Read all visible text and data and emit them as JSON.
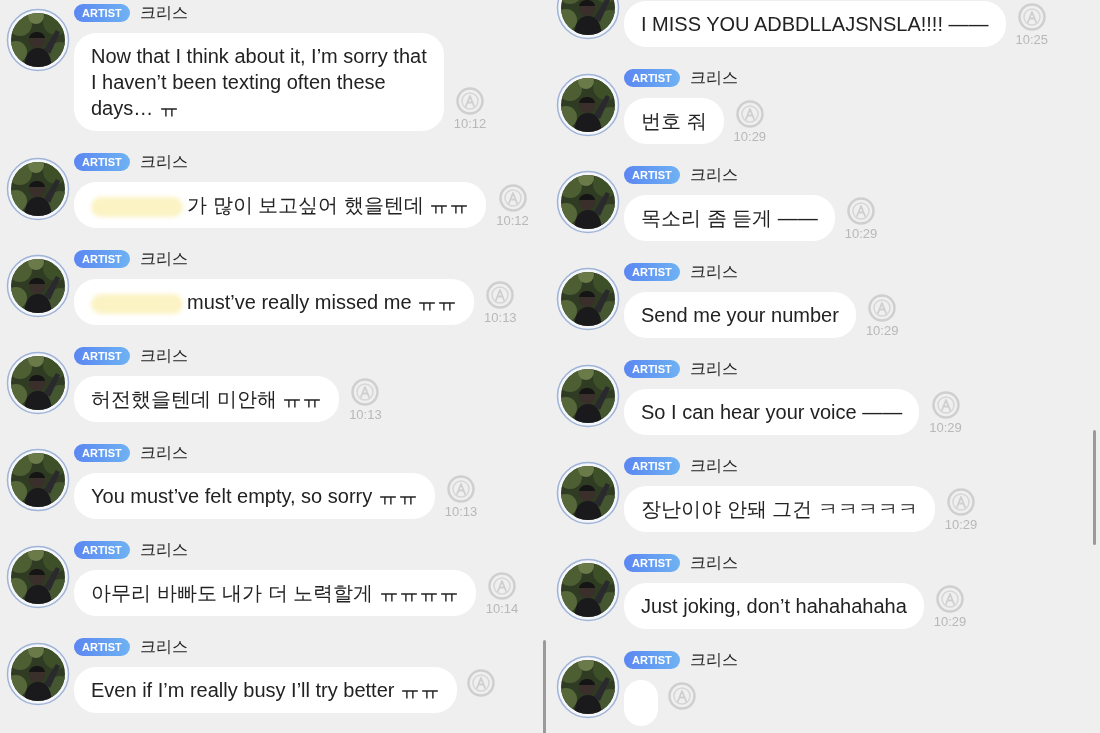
{
  "panels": [
    {
      "messages": [
        {
          "badge": "ARTIST",
          "sender": "크리스",
          "text": "Now that I think about it, I’m sorry that\nI haven’t been texting often these\ndays… ㅠ",
          "time": "10:12"
        },
        {
          "badge": "ARTIST",
          "sender": "크리스",
          "redacted": true,
          "text": "가 많이 보고싶어 했을텐데 ㅠㅠ",
          "time": "10:12"
        },
        {
          "badge": "ARTIST",
          "sender": "크리스",
          "redacted": true,
          "text": "must’ve really missed me ㅠㅠ",
          "time": "10:13"
        },
        {
          "badge": "ARTIST",
          "sender": "크리스",
          "text": "허전했을텐데 미안해 ㅠㅠ",
          "time": "10:13"
        },
        {
          "badge": "ARTIST",
          "sender": "크리스",
          "text": "You must’ve felt empty, so sorry ㅠㅠ",
          "time": "10:13"
        },
        {
          "badge": "ARTIST",
          "sender": "크리스",
          "text": "아무리 바빠도 내가 더 노력할게 ㅠㅠㅠㅠ",
          "time": "10:14"
        },
        {
          "badge": "ARTIST",
          "sender": "크리스",
          "text": "Even if I’m really busy I’ll try better ㅠㅠ"
        }
      ]
    },
    {
      "messages": [
        {
          "text": "I MISS YOU ADBDLLAJSNSLA!!!! ——",
          "time": "10:25"
        },
        {
          "badge": "ARTIST",
          "sender": "크리스",
          "text": "번호 줘",
          "time": "10:29"
        },
        {
          "badge": "ARTIST",
          "sender": "크리스",
          "text": "목소리 좀 듣게 ——",
          "time": "10:29"
        },
        {
          "badge": "ARTIST",
          "sender": "크리스",
          "text": "Send me your number",
          "time": "10:29"
        },
        {
          "badge": "ARTIST",
          "sender": "크리스",
          "text": "So I can hear your voice ——",
          "time": "10:29"
        },
        {
          "badge": "ARTIST",
          "sender": "크리스",
          "text": "장난이야 안돼 그건 ㅋㅋㅋㅋㅋ",
          "time": "10:29"
        },
        {
          "badge": "ARTIST",
          "sender": "크리스",
          "text": "Just joking, don’t hahahahaha",
          "time": "10:29"
        },
        {
          "badge": "ARTIST",
          "sender": "크리스"
        }
      ]
    }
  ]
}
